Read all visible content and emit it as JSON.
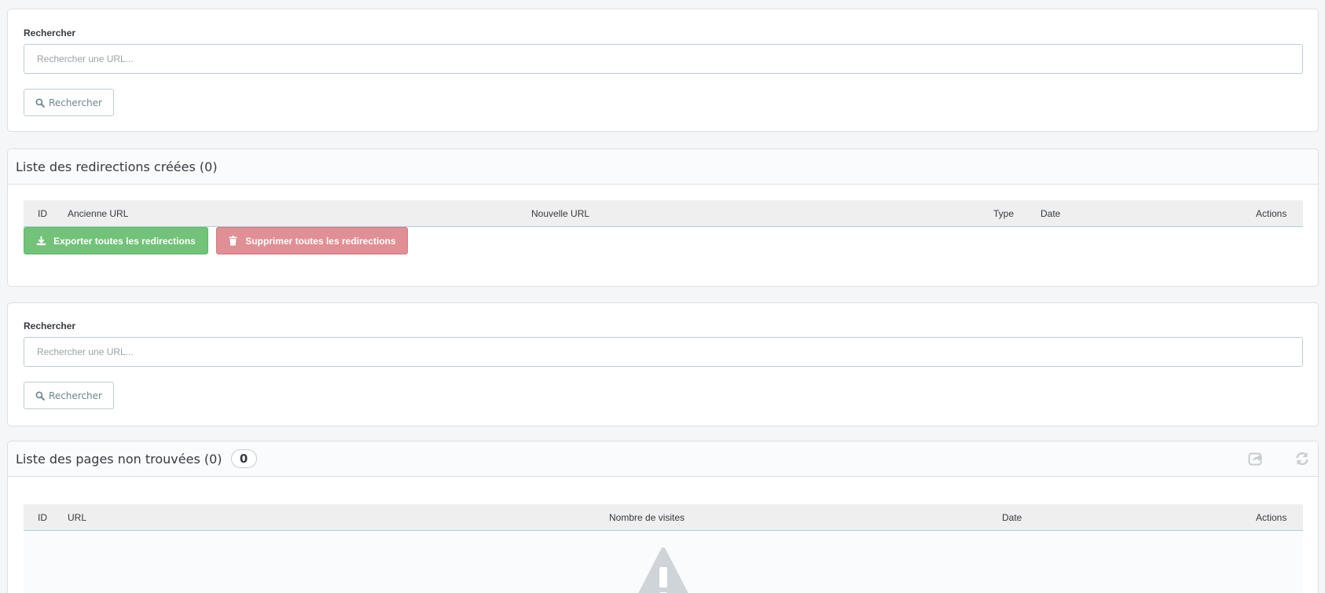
{
  "search_top": {
    "label": "Rechercher",
    "placeholder": "Rechercher une URL...",
    "button_label": "Rechercher"
  },
  "redirections": {
    "title": "Liste des redirections créées (0)",
    "columns": [
      "ID",
      "Ancienne URL",
      "Nouvelle URL",
      "Type",
      "Date",
      "Actions"
    ],
    "export_label": "Exporter toutes les redirections",
    "delete_label": "Supprimer toutes les redirections"
  },
  "search_bottom": {
    "label": "Rechercher",
    "placeholder": "Rechercher une URL...",
    "button_label": "Rechercher"
  },
  "not_found": {
    "title": "Liste des pages non trouvées (0)",
    "badge": "0",
    "columns": [
      "ID",
      "URL",
      "Nombre de visites",
      "Date",
      "Actions"
    ]
  },
  "icons": {
    "search": "search-icon",
    "download": "download-icon",
    "trash": "trash-icon",
    "export": "share-icon",
    "refresh": "refresh-icon",
    "warning": "warning-icon"
  },
  "colors": {
    "success": "#72c279",
    "danger": "#e08f95",
    "border": "#bbcdd2",
    "header_bg": "#efefef"
  }
}
